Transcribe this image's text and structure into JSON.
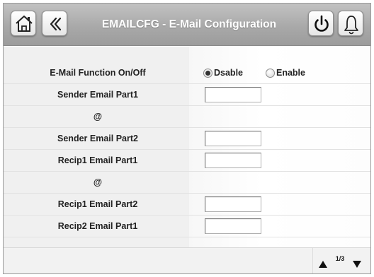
{
  "header": {
    "title": "EMAILCFG - E-Mail Configuration",
    "icons": [
      "home-icon",
      "back-chevrons-icon",
      "power-icon",
      "alarm-bell-icon"
    ]
  },
  "function_row": {
    "label": "E-Mail Function On/Off",
    "options": [
      {
        "label": "Dsable",
        "selected": true
      },
      {
        "label": "Enable",
        "selected": false
      }
    ]
  },
  "rows": [
    {
      "label": "Sender Email Part1",
      "value": ""
    },
    {
      "label": "@"
    },
    {
      "label": "Sender Email Part2",
      "value": ""
    },
    {
      "label": "Recip1 Email Part1",
      "value": ""
    },
    {
      "label": "@"
    },
    {
      "label": "Recip1 Email Part2",
      "value": ""
    },
    {
      "label": "Recip2 Email Part1",
      "value": ""
    }
  ],
  "pager": {
    "indicator": "1/3"
  },
  "colors": {
    "header": "#a9a9a9",
    "title_text": "#ffffff",
    "label_text": "#222222"
  }
}
